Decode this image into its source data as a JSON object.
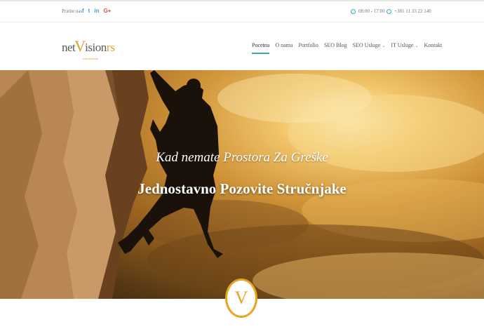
{
  "topbar": {
    "follow_label": "Pratite nas:",
    "social": [
      {
        "icon": "facebook-icon",
        "glyph": "f"
      },
      {
        "icon": "twitter-icon",
        "glyph": "t"
      },
      {
        "icon": "linkedin-icon",
        "glyph": "in"
      },
      {
        "icon": "google-plus-icon",
        "glyph": "G+"
      }
    ],
    "hours": "08:00 - 17:00",
    "phone": "+381 11 33 22 140"
  },
  "header": {
    "logo": {
      "part1": "net",
      "part2": "V",
      "part3": "ision",
      "part4": "rs",
      "tagline": "web solutions"
    },
    "nav": [
      {
        "label": "Pocetna",
        "active": true,
        "dropdown": false
      },
      {
        "label": "O nama",
        "active": false,
        "dropdown": false
      },
      {
        "label": "Portfolio",
        "active": false,
        "dropdown": false
      },
      {
        "label": "SEO Blog",
        "active": false,
        "dropdown": false
      },
      {
        "label": "SEO Usluge",
        "active": false,
        "dropdown": true
      },
      {
        "label": "IT Usluge",
        "active": false,
        "dropdown": true
      },
      {
        "label": "Kontakt",
        "active": false,
        "dropdown": false
      }
    ]
  },
  "hero": {
    "subtitle": "Kad nemate Prostora Za Greške",
    "title": "Jednostavno Pozovite Stručnjake"
  },
  "badge": {
    "letter": "V"
  },
  "colors": {
    "accent": "#3aa6b8",
    "brand": "#e0a12a",
    "social": "#3a9fd6"
  }
}
